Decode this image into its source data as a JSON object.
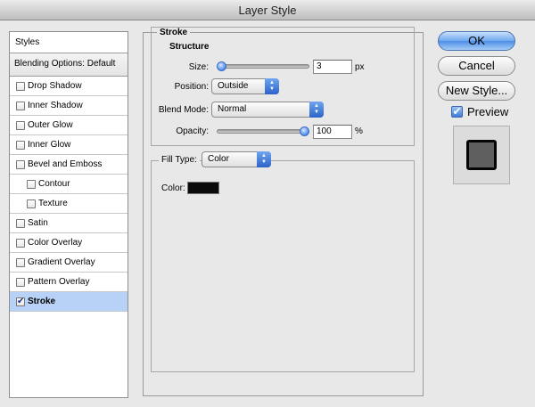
{
  "window": {
    "title": "Layer Style"
  },
  "styles_panel": {
    "header": "Styles",
    "blending_options": "Blending Options: Default",
    "items": [
      {
        "label": "Drop Shadow",
        "checked": false,
        "sub": false
      },
      {
        "label": "Inner Shadow",
        "checked": false,
        "sub": false
      },
      {
        "label": "Outer Glow",
        "checked": false,
        "sub": false
      },
      {
        "label": "Inner Glow",
        "checked": false,
        "sub": false
      },
      {
        "label": "Bevel and Emboss",
        "checked": false,
        "sub": false
      },
      {
        "label": "Contour",
        "checked": false,
        "sub": true
      },
      {
        "label": "Texture",
        "checked": false,
        "sub": true
      },
      {
        "label": "Satin",
        "checked": false,
        "sub": false
      },
      {
        "label": "Color Overlay",
        "checked": false,
        "sub": false
      },
      {
        "label": "Gradient Overlay",
        "checked": false,
        "sub": false
      },
      {
        "label": "Pattern Overlay",
        "checked": false,
        "sub": false
      },
      {
        "label": "Stroke",
        "checked": true,
        "sub": false,
        "selected": true
      }
    ],
    "check_mark": "✔"
  },
  "stroke": {
    "title": "Stroke",
    "structure_title": "Structure",
    "size_label": "Size:",
    "size_value": "3",
    "size_unit": "px",
    "position_label": "Position:",
    "position_value": "Outside",
    "blend_mode_label": "Blend Mode:",
    "blend_mode_value": "Normal",
    "opacity_label": "Opacity:",
    "opacity_value": "100",
    "opacity_unit": "%",
    "fill_type_label": "Fill Type:",
    "fill_type_value": "Color",
    "color_label": "Color:",
    "color_value": "#0a0a0a",
    "size_slider_fraction": 0.0,
    "opacity_slider_fraction": 1.0
  },
  "buttons": {
    "ok": "OK",
    "cancel": "Cancel",
    "new_style": "New Style...",
    "preview_label": "Preview",
    "preview_checked": true
  },
  "icons": {
    "popup_arrows": "▲▼"
  }
}
